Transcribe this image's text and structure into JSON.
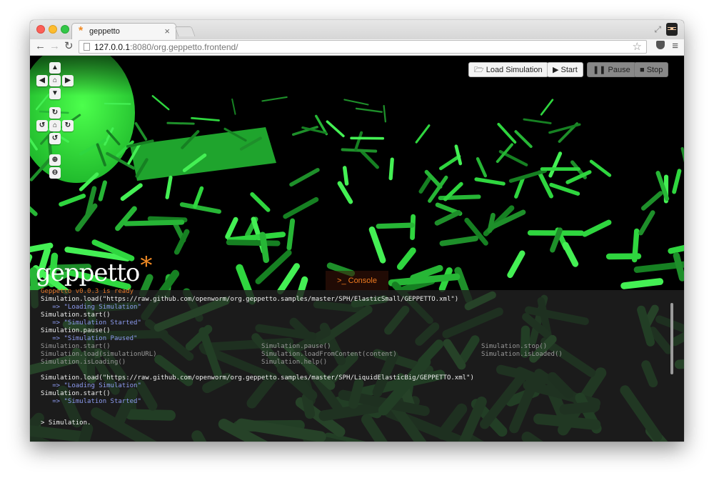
{
  "browser": {
    "tab_title": "geppetto",
    "tab_close": "×",
    "url_host": "127.0.0.1",
    "url_rest": ":8080/org.geppetto.frontend/"
  },
  "sim_controls": {
    "load_label": "Load Simulation",
    "start_label": "Start",
    "pause_label": "Pause",
    "stop_label": "Stop"
  },
  "logo": {
    "text": "geppetto",
    "mark": "*"
  },
  "console": {
    "tab_label": "Console",
    "lines": {
      "l0": "Geppetto v0.0.3 is ready",
      "l1": "Simulation.load(\"https://raw.github.com/openworm/org.geppetto.samples/master/SPH/ElasticSmall/GEPPETTO.xml\")",
      "l2": "   => \"Loading Simulation\"",
      "l3": "Simulation.start()",
      "l4": "   => \"Simulation Started\"",
      "l5": "Simulation.pause()",
      "l6": "   => \"Simulation Paused\"",
      "l7": "Simulation.load(\"https://raw.github.com/openworm/org.geppetto.samples/master/SPH/LiquidElasticBig/GEPPETTO.xml\")",
      "l8": "   => \"Loading Simulation\"",
      "l9": "Simulation.start()",
      "l10": "   => \"Simulation Started\""
    },
    "hints": {
      "h1": "Simulation.start()",
      "h2": "Simulation.load(simulationURL)",
      "h3": "Simulation.isLoading()",
      "h4": "Simulation.pause()",
      "h5": "Simulation.loadFromContent(content)",
      "h6": "Simulation.help()",
      "h7": "Simulation.stop()",
      "h8": "Simulation.isLoaded()"
    },
    "prompt": "> Simulation."
  },
  "colors": {
    "accent": "#f08a24",
    "scene_green": "#2ed63a"
  }
}
